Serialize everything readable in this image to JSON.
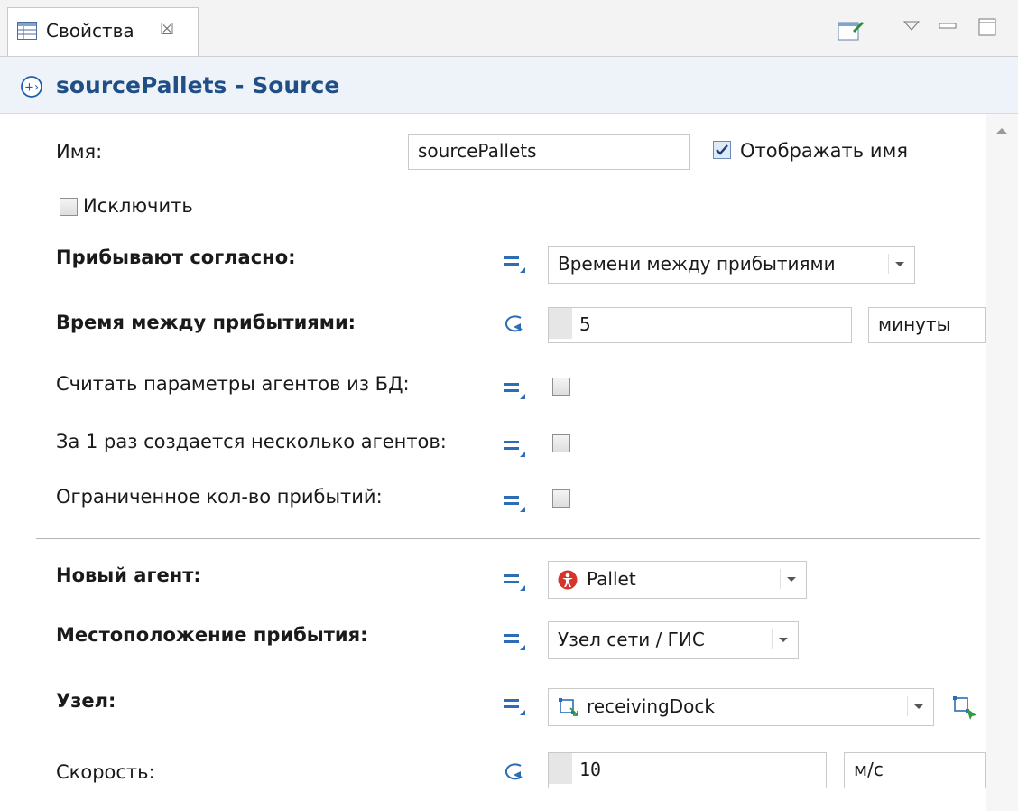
{
  "tab": {
    "title": "Свойства",
    "close_glyph": "☒"
  },
  "header": {
    "title": "sourcePallets - Source",
    "icon": "source-icon"
  },
  "form": {
    "name_label": "Имя:",
    "name_value": "sourcePallets",
    "show_name_label": "Отображать имя",
    "show_name_checked": true,
    "exclude_label": "Исключить",
    "exclude_checked": false,
    "arrivals_label": "Прибывают согласно:",
    "arrivals_value": "Времени между прибытиями",
    "interarrival_label": "Время между прибытиями:",
    "interarrival_value": "5",
    "interarrival_unit": "минуты",
    "read_db_label": "Считать параметры агентов из БД:",
    "multiple_label": "За 1 раз создается несколько агентов:",
    "limited_label": "Ограниченное кол-во прибытий:",
    "new_agent_label": "Новый агент:",
    "new_agent_value": "Pallet",
    "location_label": "Местоположение прибытия:",
    "location_value": "Узел сети / ГИС",
    "node_label": "Узел:",
    "node_value": "receivingDock",
    "speed_label": "Скорость:",
    "speed_value": "10",
    "speed_unit": "м/с"
  },
  "colors": {
    "accent": "#1f5fa8",
    "header_bg": "#eef3f9",
    "tab_bg": "#ffffff",
    "agent_icon": "#d9342b"
  }
}
